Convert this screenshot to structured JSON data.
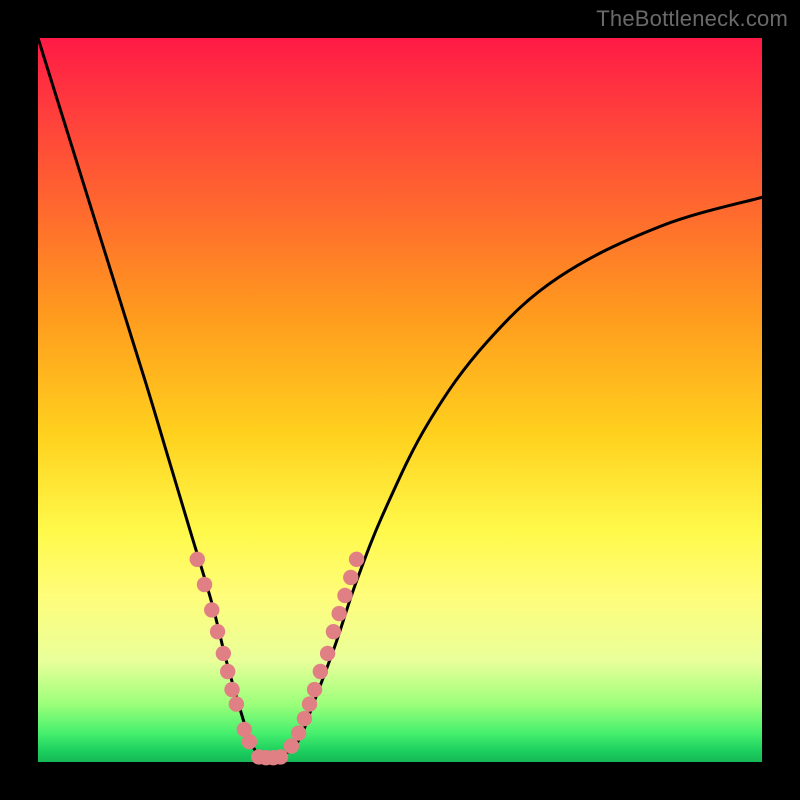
{
  "watermark": "TheBottleneck.com",
  "chart_data": {
    "type": "line",
    "title": "",
    "xlabel": "",
    "ylabel": "",
    "xlim": [
      0,
      100
    ],
    "ylim": [
      0,
      100
    ],
    "series": [
      {
        "name": "curve",
        "x": [
          0,
          5,
          10,
          15,
          18,
          21,
          24,
          26,
          28,
          29.5,
          31,
          33.5,
          36,
          38,
          41,
          44,
          48,
          54,
          62,
          72,
          86,
          100
        ],
        "values": [
          100,
          84,
          68,
          52,
          42,
          32,
          22,
          14,
          7,
          2.5,
          0.8,
          0.8,
          3,
          8,
          16,
          25,
          35,
          47,
          58,
          67,
          74,
          78
        ]
      }
    ],
    "markers": [
      {
        "series": "left-dots",
        "x": [
          22,
          23,
          24,
          24.8,
          25.6,
          26.2,
          26.8,
          27.4,
          28.5,
          29.2
        ],
        "values": [
          28,
          24.5,
          21,
          18,
          15,
          12.5,
          10,
          8,
          4.5,
          2.8
        ],
        "color": "#e08084",
        "size": 10
      },
      {
        "series": "right-dots",
        "x": [
          35,
          36,
          36.8,
          37.5,
          38.2,
          39,
          40,
          40.8,
          41.6,
          42.4,
          43.2,
          44
        ],
        "values": [
          2.2,
          4,
          6,
          8,
          10,
          12.5,
          15,
          18,
          20.5,
          23,
          25.5,
          28
        ],
        "color": "#e08084",
        "size": 10
      },
      {
        "series": "bottom-dots",
        "x": [
          30.5,
          31.5,
          32.5,
          33.5
        ],
        "values": [
          0.7,
          0.6,
          0.6,
          0.7
        ],
        "color": "#e08084",
        "size": 10
      }
    ]
  }
}
